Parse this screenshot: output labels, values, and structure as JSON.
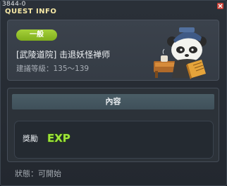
{
  "window": {
    "quest_id": "3844-0",
    "title": "QUEST INFO"
  },
  "quest": {
    "category": "一般",
    "name": "[武陵道院] 击退妖怪禅师",
    "recommended_level": "建議等級：135～139"
  },
  "content": {
    "header": "內容",
    "reward_label": "獎勵",
    "reward_icon": "EXP"
  },
  "status": {
    "label": "狀態：",
    "value": "可開始"
  },
  "colors": {
    "title_yellow": "#f7e9a6",
    "badge_green": "#8fbd26",
    "exp_green": "#9fe43a",
    "close_red": "#c9443a"
  }
}
